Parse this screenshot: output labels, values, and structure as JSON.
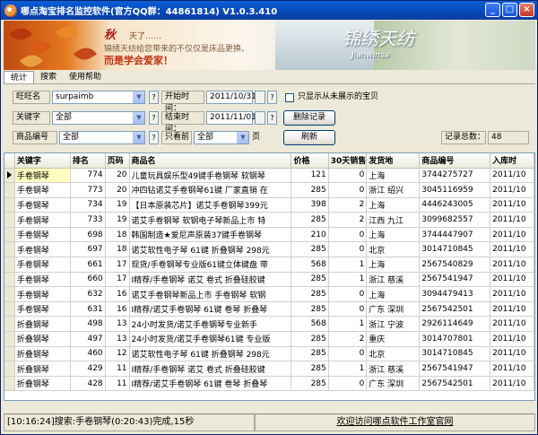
{
  "window": {
    "title": "哪点淘宝排名监控软件(官方QQ群：44861814) V1.0.3.410"
  },
  "banner": {
    "line1": "秋",
    "line1b": "天了……",
    "line2": "锦绣天纺给您带来的不仅仅是床品更换、",
    "line3": "而是学会爱家！",
    "logo": "锦绣天纺",
    "logo_en": "Jianwinsa"
  },
  "menu": [
    "统计",
    "搜索",
    "使用帮助"
  ],
  "filters": {
    "shop_label": "旺旺名",
    "shop_value": "surpaimb",
    "keyword_label": "关键字",
    "keyword_value": "全部",
    "code_label": "商品编号",
    "code_value": "全部",
    "start_label": "开始时间：",
    "start_value": "2011/10/31",
    "end_label": "结束时间：",
    "end_value": "2011/11/01",
    "topn_label": "只看前",
    "topn_value": "全部",
    "topn_unit": "页",
    "help_glyph": "?",
    "only_unseen_label": "只显示从未展示的宝贝",
    "delete_button": "删除记录",
    "refresh_button": "刷新",
    "total_label": "记录总数：",
    "total_value": "48"
  },
  "table": {
    "columns": [
      "关键字",
      "排名",
      "页码",
      "商品名",
      "价格",
      "30天销售",
      "发货地",
      "商品编号",
      "入库时"
    ],
    "rows": [
      [
        "手卷钢琴",
        "774",
        "20",
        "儿童玩具娱乐型49键手卷钢琴 软钢琴",
        "121",
        "0",
        "上海",
        "3744275727",
        "2011/10"
      ],
      [
        "手卷钢琴",
        "773",
        "20",
        "冲四钻诺艾手卷钢琴61键 厂家直销 在",
        "285",
        "0",
        "浙江 绍兴",
        "3045116959",
        "2011/10"
      ],
      [
        "手卷钢琴",
        "734",
        "19",
        "【日本原装芯片】诺艾手卷钢琴399元",
        "398",
        "2",
        "上海",
        "4446243005",
        "2011/10"
      ],
      [
        "手卷钢琴",
        "733",
        "19",
        "诺艾手卷钢琴 软钢电子琴新品上市 特",
        "285",
        "2",
        "江西 九江",
        "3099682557",
        "2011/10"
      ],
      [
        "手卷钢琴",
        "698",
        "18",
        "韩国制造★爱尼声原装37键手卷钢琴",
        "210",
        "0",
        "上海",
        "3744447907",
        "2011/10"
      ],
      [
        "手卷钢琴",
        "697",
        "18",
        "诺艾软性电子琴 61键 折叠钢琴 298元",
        "285",
        "0",
        "北京",
        "3014710845",
        "2011/10"
      ],
      [
        "手卷钢琴",
        "661",
        "17",
        "现货/手卷钢琴专业版61键立体键盘 带",
        "568",
        "1",
        "上海",
        "2567540829",
        "2011/10"
      ],
      [
        "手卷钢琴",
        "660",
        "17",
        "I精荐/手卷钢琴 诺艾 卷式 折叠硅胶键",
        "285",
        "1",
        "浙江 慈溪",
        "2567541947",
        "2011/10"
      ],
      [
        "手卷钢琴",
        "632",
        "16",
        "诺艾手卷钢琴新品上市 手卷钢琴 软钢",
        "285",
        "0",
        "上海",
        "3094479413",
        "2011/10"
      ],
      [
        "手卷钢琴",
        "631",
        "16",
        "I精荐/诺艾手卷钢琴 61键 卷琴 折叠琴",
        "285",
        "0",
        "广东 深圳",
        "2567542501",
        "2011/10"
      ],
      [
        "折叠钢琴",
        "498",
        "13",
        "24小时发货/诺艾手卷钢琴专业新手",
        "568",
        "1",
        "浙江 宁波",
        "2926114649",
        "2011/10"
      ],
      [
        "折叠钢琴",
        "497",
        "13",
        "24小时发货/诺艾手卷钢琴61键 专业版",
        "285",
        "2",
        "重庆",
        "3014707801",
        "2011/10"
      ],
      [
        "折叠钢琴",
        "460",
        "12",
        "诺艾软性电子琴 61键 折叠钢琴 298元",
        "285",
        "0",
        "北京",
        "3014710845",
        "2011/10"
      ],
      [
        "折叠钢琴",
        "429",
        "11",
        "I精荐/手卷钢琴 诺艾 卷式 折叠硅胶键",
        "285",
        "1",
        "浙江 慈溪",
        "2567541947",
        "2011/10"
      ],
      [
        "折叠钢琴",
        "428",
        "11",
        "I精荐/诺艾手卷钢琴 61键 卷琴 折叠琴",
        "285",
        "0",
        "广东 深圳",
        "2567542501",
        "2011/10"
      ]
    ]
  },
  "status": {
    "left": "[10:16:24]搜索:手卷钢琴(0:20:43)完成,15秒",
    "right": "欢迎访问哪点软件工作室官网"
  }
}
